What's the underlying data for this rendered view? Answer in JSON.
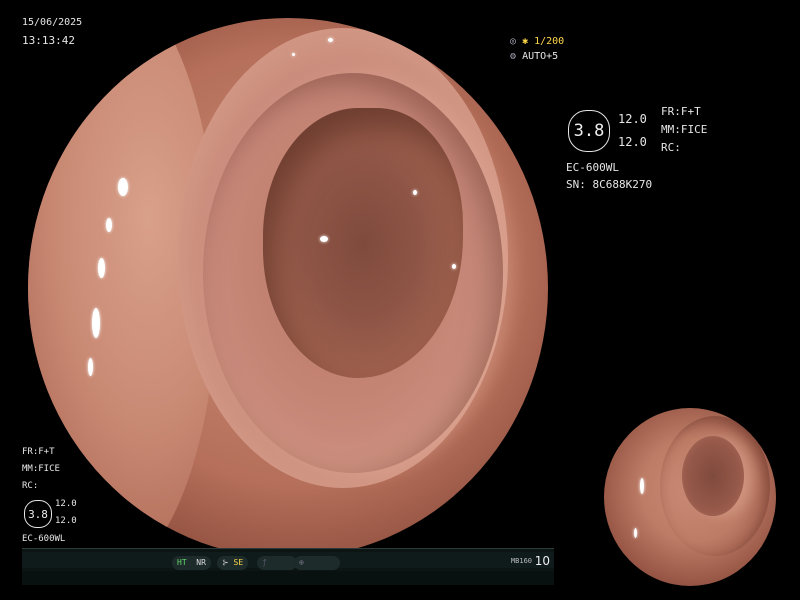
{
  "header": {
    "date": "15/06/2025",
    "time": "13:13:42"
  },
  "exposure": {
    "shutter": "✱ 1/200",
    "iris": "AUTO+5",
    "color_accent": "#ffd84a"
  },
  "settings_right": {
    "zoom": "3.8",
    "value_1": "12.0",
    "value_2": "12.0",
    "scope": "EC-600WL",
    "serial": "SN: 8C688K270",
    "fr": "FR:F+T",
    "mm": "MM:FICE",
    "rc": "RC:"
  },
  "settings_left": {
    "fr": "FR:F+T",
    "mm": "MM:FICE",
    "rc": "RC:",
    "zoom": "3.8",
    "value_1": "12.0",
    "value_2": "12.0",
    "scope": "EC-600WL"
  },
  "status_bar": {
    "ht": "HT",
    "nr": "NR",
    "se": "SE",
    "model": "MB160",
    "number": "10",
    "color_accent": "#63d86b"
  },
  "icons": [
    "shutter-icon",
    "iris-icon",
    "se-icon",
    "pen-icon",
    "record-icon"
  ]
}
